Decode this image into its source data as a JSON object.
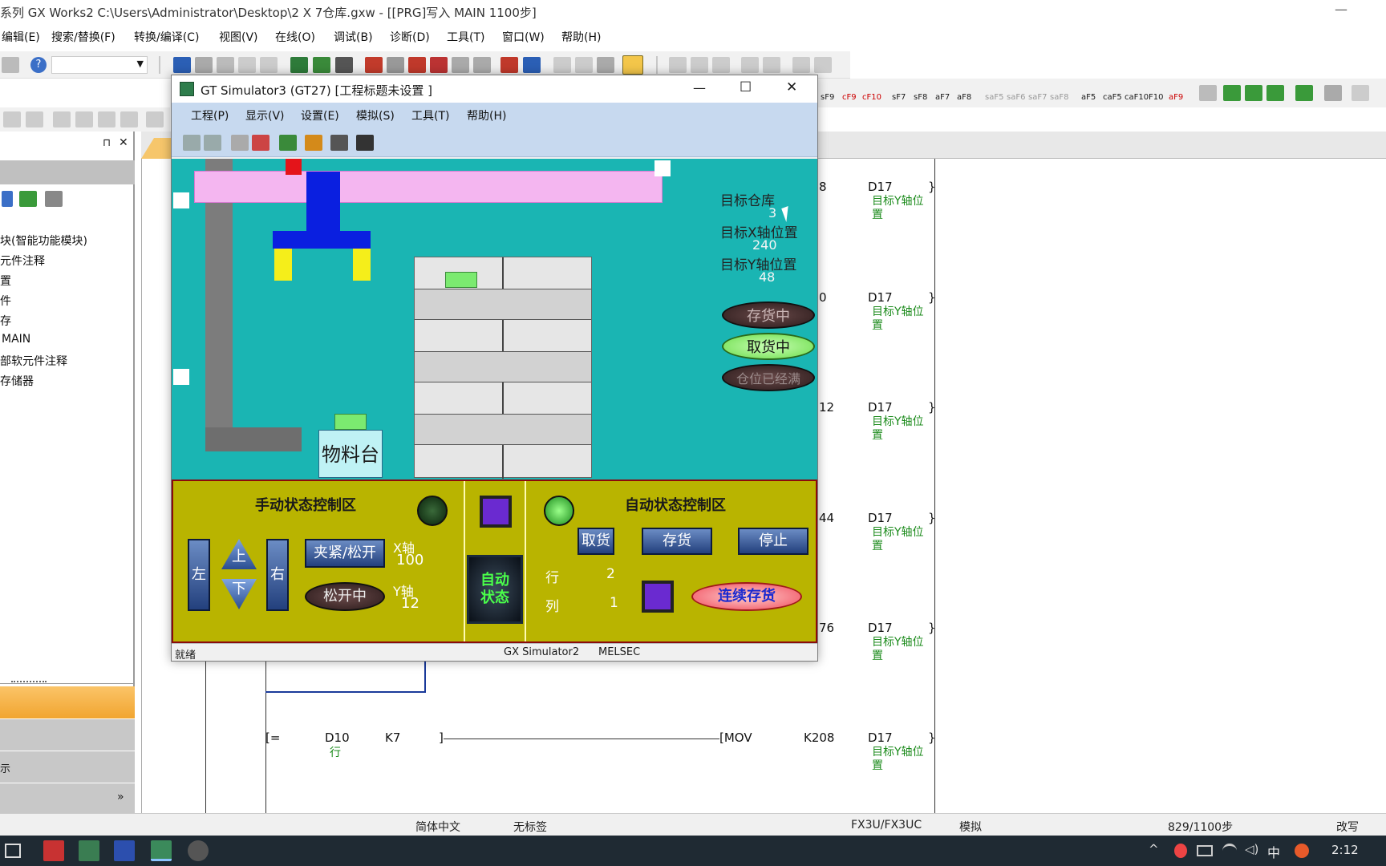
{
  "main_window": {
    "title": "系列 GX Works2 C:\\Users\\Administrator\\Desktop\\2 X 7仓库.gxw - [[PRG]写入 MAIN 1100步]",
    "minimize": "—",
    "menu": [
      "编辑(E)",
      "搜索/替换(F)",
      "转换/编译(C)",
      "视图(V)",
      "在线(O)",
      "调试(B)",
      "诊断(D)",
      "工具(T)",
      "窗口(W)",
      "帮助(H)"
    ],
    "toolbar2_labels": [
      "sF9",
      "cF9",
      "cF10",
      "sF7",
      "sF8",
      "aF7",
      "aF8",
      "saF5",
      "saF6",
      "saF7",
      "saF8",
      "aF5",
      "caF5",
      "caF10",
      "F10",
      "aF9"
    ]
  },
  "project_tree": {
    "pin": "⊓",
    "close": "✕",
    "items": [
      "块(智能功能模块)",
      "元件注释",
      "置",
      "件",
      "存",
      "MAIN",
      "部软元件注释",
      "存储器"
    ],
    "bottom_label": "示",
    "expand": "»"
  },
  "ladder": {
    "rungs": [
      {
        "partial": "8",
        "device": "D17",
        "comment": "目标Y轴位\n置"
      },
      {
        "partial": "0",
        "device": "D17",
        "comment": "目标Y轴位\n置"
      },
      {
        "partial": "12",
        "device": "D17",
        "comment": "目标Y轴位\n置"
      },
      {
        "partial": "44",
        "device": "D17",
        "comment": "目标Y轴位\n置"
      },
      {
        "partial": "76",
        "device": "D17",
        "comment": "目标Y轴位\n置"
      }
    ],
    "last_rung": {
      "cmp": "[=",
      "src": "D10",
      "src_comment": "行",
      "const": "K7",
      "close": "]",
      "instr": "[MOV",
      "val": "K208",
      "dst": "D17",
      "dst_comment": "目标Y轴位\n置",
      "end": "}"
    }
  },
  "status_bar": {
    "language": "简体中文",
    "label": "无标签",
    "cpu": "FX3U/FX3UC",
    "mode": "模拟",
    "steps": "829/1100步",
    "edit": "改写"
  },
  "taskbar": {
    "ime": "中",
    "clock": "2:12"
  },
  "gt_window": {
    "title": "GT Simulator3 (GT27)  [工程标题未设置 ]",
    "controls": {
      "minimize": "—",
      "maximize": "☐",
      "close": "✕"
    },
    "menu": [
      "工程(P)",
      "显示(V)",
      "设置(E)",
      "模拟(S)",
      "工具(T)",
      "帮助(H)"
    ],
    "screen": {
      "target_warehouse_label": "目标仓库",
      "target_warehouse_value": "3",
      "target_x_label": "目标X轴位置",
      "target_x_value": "240",
      "target_y_label": "目标Y轴位置",
      "target_y_value": "48",
      "status_storing": "存货中",
      "status_picking": "取货中",
      "status_full": "仓位已经满",
      "material_table": "物料台"
    },
    "panel": {
      "manual_title": "手动状态控制区",
      "auto_title": "自动状态控制区",
      "left": "左",
      "right": "右",
      "up": "上",
      "down": "下",
      "clamp": "夹紧/松开",
      "releasing": "松开中",
      "x_axis_label": "X轴",
      "x_axis_value": "100",
      "y_axis_label": "Y轴",
      "y_axis_value": "12",
      "auto_state": "自动\n状态",
      "pick": "取货",
      "store": "存货",
      "stop": "停止",
      "row_label": "行",
      "row_value": "2",
      "col_label": "列",
      "col_value": "1",
      "continuous_store": "连续存货"
    },
    "status": {
      "ready": "就绪",
      "sim": "GX Simulator2",
      "vendor": "MELSEC"
    },
    "colors": {
      "screen_bg": "#1ab5b3",
      "panel_bg": "#b9b400",
      "crane_bar": "#f4b6f0",
      "gripper": "#0a1fe0",
      "finger": "#f5ee1a",
      "item": "#7bea70"
    }
  }
}
